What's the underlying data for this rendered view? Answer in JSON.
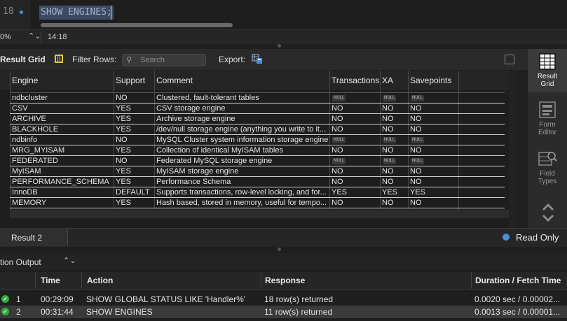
{
  "editor": {
    "line_number": "18",
    "sql": "SHOW ENGINES;"
  },
  "status": {
    "zoom": "0%",
    "zoom_arrows": "⌃⌄",
    "cursor_pos": "14:18"
  },
  "result_toolbar": {
    "title": "Result Grid",
    "filter_label": "Filter Rows:",
    "search_placeholder": "Search",
    "export_label": "Export:"
  },
  "grid": {
    "columns": [
      "Engine",
      "Support",
      "Comment",
      "Transactions",
      "XA",
      "Savepoints"
    ],
    "rows": [
      [
        "ndbcluster",
        "NO",
        "Clustered, fault-tolerant tables",
        "NULL",
        "NULL",
        "NULL"
      ],
      [
        "CSV",
        "YES",
        "CSV storage engine",
        "NO",
        "NO",
        "NO"
      ],
      [
        "ARCHIVE",
        "YES",
        "Archive storage engine",
        "NO",
        "NO",
        "NO"
      ],
      [
        "BLACKHOLE",
        "YES",
        "/dev/null storage engine (anything you write to it...",
        "NO",
        "NO",
        "NO"
      ],
      [
        "ndbinfo",
        "NO",
        "MySQL Cluster system information storage engine",
        "NULL",
        "NULL",
        "NULL"
      ],
      [
        "MRG_MYISAM",
        "YES",
        "Collection of identical MyISAM tables",
        "NO",
        "NO",
        "NO"
      ],
      [
        "FEDERATED",
        "NO",
        "Federated MySQL storage engine",
        "NULL",
        "NULL",
        "NULL"
      ],
      [
        "MyISAM",
        "YES",
        "MyISAM storage engine",
        "NO",
        "NO",
        "NO"
      ],
      [
        "PERFORMANCE_SCHEMA",
        "YES",
        "Performance Schema",
        "NO",
        "NO",
        "NO"
      ],
      [
        "InnoDB",
        "DEFAULT",
        "Supports transactions, row-level locking, and for...",
        "YES",
        "YES",
        "YES"
      ],
      [
        "MEMORY",
        "YES",
        "Hash based, stored in memory, useful for tempo...",
        "NO",
        "NO",
        "NO"
      ]
    ]
  },
  "sidebar": {
    "result_grid": [
      "Result",
      "Grid"
    ],
    "form_editor": [
      "Form",
      "Editor"
    ],
    "field_types": [
      "Field",
      "Types"
    ]
  },
  "tabs": {
    "result_tab": "Result 2",
    "read_only": "Read Only"
  },
  "output": {
    "label": "tion Output",
    "arrows": "⌃⌄",
    "columns": [
      "Time",
      "Action",
      "Response",
      "Duration / Fetch Time"
    ],
    "rows": [
      {
        "num": "1",
        "time": "00:29:09",
        "action": "SHOW GLOBAL STATUS LIKE 'Handler%'",
        "response": "18 row(s) returned",
        "duration": "0.0020 sec / 0.00002..."
      },
      {
        "num": "2",
        "time": "00:31:44",
        "action": "SHOW ENGINES",
        "response": "11 row(s) returned",
        "duration": "0.0013 sec / 0.00001..."
      }
    ]
  },
  "colors": {
    "accent": "#4b8fe0",
    "ok": "#2faa3c",
    "selection": "#3c4b63"
  }
}
